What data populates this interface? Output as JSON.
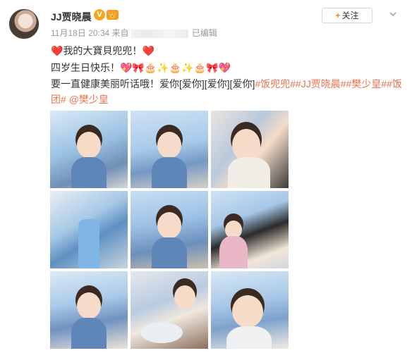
{
  "post": {
    "author": {
      "name": "JJ贾晓晨",
      "verified_badge": "V",
      "member_badge": "👑"
    },
    "meta": {
      "date": "11月18日 20:34",
      "source_prefix": "来自",
      "edited": "已编辑"
    },
    "follow": {
      "plus": "+",
      "label": "关注"
    },
    "text": {
      "line1_heart_left": "❤️",
      "line1": "我的大寶貝兜兜！",
      "line1_heart_right": "❤️",
      "line2": "四岁生日快乐！",
      "line2_emoji": "💖🎀🎂✨🎂✨🎂🎀💖",
      "line3": "要一直健康美丽听话哦！爱你[爱你][爱你][爱你]",
      "line3_topics": "#饭兜兜##JJ贾晓晨##樊少皇##饭",
      "line4_topic": "团#",
      "line4_mention": "@樊少皇"
    },
    "photos": [
      {
        "name": "photo-1"
      },
      {
        "name": "photo-2"
      },
      {
        "name": "photo-3"
      },
      {
        "name": "photo-4"
      },
      {
        "name": "photo-5"
      },
      {
        "name": "photo-6"
      },
      {
        "name": "photo-7"
      },
      {
        "name": "photo-8"
      },
      {
        "name": "photo-9"
      }
    ]
  },
  "colors": {
    "link": "#eb7350",
    "follow_plus": "#ff8200",
    "verified": "#f5a623",
    "heart": "#e63232"
  },
  "icons": {
    "verified": "verified-icon",
    "member": "member-crown-icon",
    "more": "chevron-down-icon"
  }
}
